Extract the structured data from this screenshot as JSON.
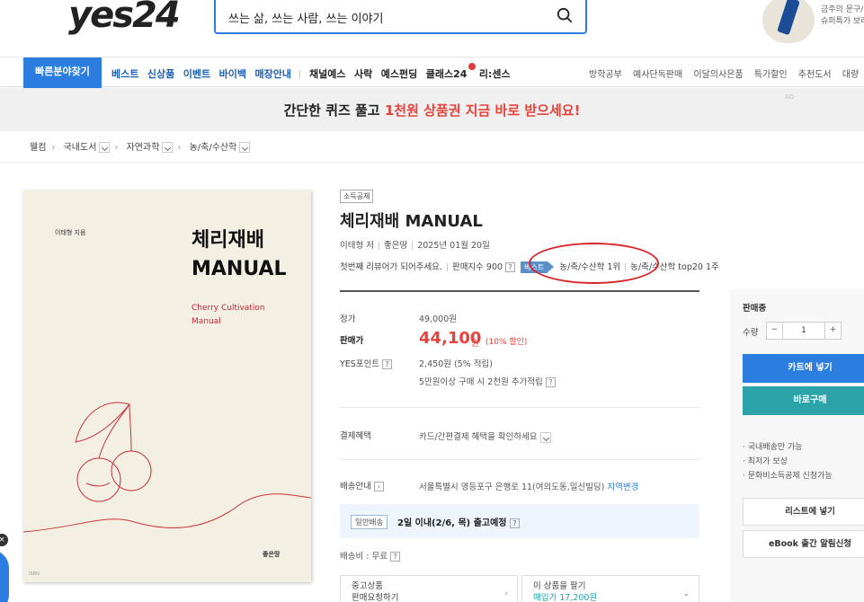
{
  "header": {
    "logo": "yes24",
    "search_placeholder": "쓰는 삶, 쓰는 사람, 쓰는 이야기",
    "promo_line1": "금주의 문구/",
    "promo_line2": "슈퍼특가 보러"
  },
  "nav": {
    "category_button": "빠른분야찾기",
    "main_links": [
      "베스트",
      "신상품",
      "이벤트",
      "바이백",
      "매장안내"
    ],
    "sub_links": [
      "채널예스",
      "사락",
      "예스펀딩",
      "클래스24",
      "리:센스"
    ],
    "right_links": [
      "방학공부",
      "예사단독판매",
      "이달의사은품",
      "특가할인",
      "추천도서",
      "대량"
    ]
  },
  "banner": {
    "text_before": "간단한 퀴즈 풀고 ",
    "text_highlight": "1천원 상품권 지금 바로 받으세요!",
    "ad_tag": "AD"
  },
  "breadcrumb": {
    "home": "웰컴",
    "items": [
      "국내도서",
      "자연과학",
      "농/축/수산학"
    ]
  },
  "cover": {
    "author": "이태형 지음",
    "title_line1": "체리재배",
    "title_line2": "MANUAL",
    "subtitle_line1": "Cherry Cultivation",
    "subtitle_line2": "Manual",
    "publisher": "좋은땅",
    "code": "ISBN"
  },
  "product": {
    "tag": "소득공제",
    "title": "체리재배 MANUAL",
    "author": "이태형 저",
    "publisher": "좋은땅",
    "date": "2025년 01월 20일",
    "review_prompt": "첫번째 리뷰어가 되어주세요.",
    "sales_index": "판매지수 900",
    "best_badge": "베스트",
    "best_rank": "농/축/수산학 1위",
    "best_top20": "농/축/수산학 top20 1주"
  },
  "price": {
    "list_label": "정가",
    "list_value": "49,000원",
    "sale_label": "판매가",
    "sale_value": "44,100",
    "sale_unit": "원",
    "sale_discount": "(10% 할인)",
    "point_label": "YES포인트",
    "point_value": "2,450원 (5% 적립)",
    "point_extra": "5만원이상 구매 시 2천원 추가적립",
    "pay_label": "결제혜택",
    "pay_value": "카드/간편결제 혜택을 확인하세요",
    "ship_label": "배송안내",
    "ship_address": "서울특별시 영등포구 은행로 11(여의도동,일신빌딩)",
    "ship_change": "지역변경",
    "ship_type": "일반배송",
    "ship_eta": "2일 이내(2/6, 목) 출고예정",
    "ship_fee": "배송비 : 무료",
    "used_line1": "중고상품",
    "used_line2": "판매요청하기",
    "sell_line1": "이 상품을 팔기",
    "sell_line2": "매입가 17,200원"
  },
  "side": {
    "status": "판매중",
    "qty_label": "수량",
    "qty_value": "1",
    "cart_button": "카트에 넣기",
    "buy_button": "바로구매",
    "notes": [
      "국내배송만 가능",
      "최저가 보상",
      "문화비소득공제 신청가능"
    ],
    "list_button": "리스트에 넣기",
    "ebook_button": "eBook 출간 알림신청"
  },
  "colors": {
    "accent": "#2b7de0",
    "sale": "#e8423c",
    "buy": "#2ba3a8",
    "highlight_oval": "#d9262b"
  }
}
